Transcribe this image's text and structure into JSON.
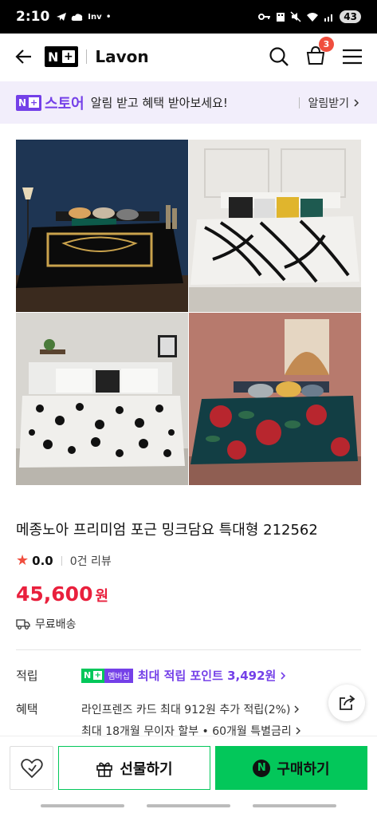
{
  "status_bar": {
    "time": "2:10",
    "battery": "43"
  },
  "header": {
    "store_name": "Lavon",
    "cart_count": "3"
  },
  "banner": {
    "logo_text": "N",
    "store_label": "스토어",
    "message": "알림 받고 혜택 받아보세요!",
    "action": "알림받기"
  },
  "product": {
    "title": "메종노아 프리미엄 포근 밍크담요 특대형 212562",
    "rating": "0.0",
    "review_count": "0건 리뷰",
    "price": "45,600",
    "price_unit": "원",
    "shipping": "무료배송"
  },
  "info": {
    "points_label": "적립",
    "membership_badge": "멤버십",
    "points_text": "최대 적립 포인트 3,492원",
    "benefit_label": "혜택",
    "benefit_1": "라인프렌즈 카드 최대 912원 추가 적립(2%)",
    "benefit_2": "최대 18개월 무이자 할부 • 60개월 특별금리"
  },
  "bottom": {
    "gift_label": "선물하기",
    "buy_label": "구매하기"
  },
  "colors": {
    "naver_green": "#03c75a",
    "store_purple": "#7440e8",
    "price_red": "#e9203d",
    "badge_red": "#f04e3e"
  }
}
